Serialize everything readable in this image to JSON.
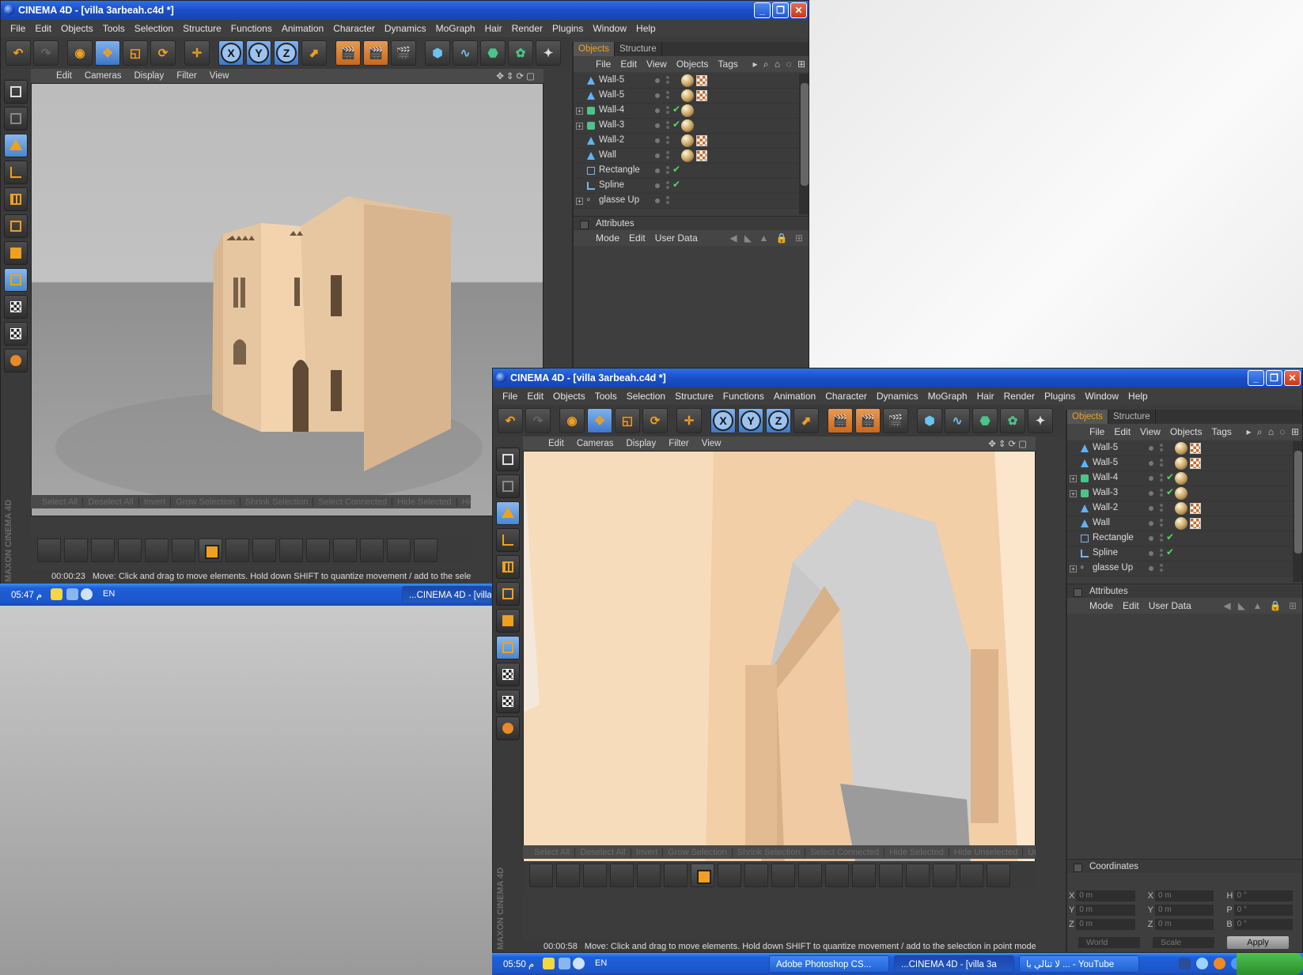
{
  "window1": {
    "title": "CINEMA 4D - [villa 3arbeah.c4d *]",
    "menu": [
      "File",
      "Edit",
      "Objects",
      "Tools",
      "Selection",
      "Structure",
      "Functions",
      "Animation",
      "Character",
      "Dynamics",
      "MoGraph",
      "Hair",
      "Render",
      "Plugins",
      "Window",
      "Help"
    ],
    "viewport_menu": [
      "Edit",
      "Cameras",
      "Display",
      "Filter",
      "View"
    ],
    "tabs": [
      "Objects",
      "Structure"
    ],
    "objects_menu": [
      "File",
      "Edit",
      "View",
      "Objects",
      "Tags"
    ],
    "objects": [
      {
        "name": "Wall-5",
        "icon": "polygon",
        "expand": false,
        "check": false,
        "tags": [
          "mat",
          "uv"
        ]
      },
      {
        "name": "Wall-5",
        "icon": "polygon",
        "expand": false,
        "check": false,
        "tags": [
          "mat",
          "uv"
        ]
      },
      {
        "name": "Wall-4",
        "icon": "cube",
        "expand": true,
        "check": true,
        "tags": [
          "mat"
        ]
      },
      {
        "name": "Wall-3",
        "icon": "cube",
        "expand": true,
        "check": true,
        "tags": [
          "mat"
        ]
      },
      {
        "name": "Wall-2",
        "icon": "polygon",
        "expand": false,
        "check": false,
        "tags": [
          "mat",
          "uv"
        ]
      },
      {
        "name": "Wall",
        "icon": "polygon",
        "expand": false,
        "check": false,
        "tags": [
          "mat",
          "uv"
        ]
      },
      {
        "name": "Rectangle",
        "icon": "rect",
        "expand": false,
        "check": true,
        "tags": []
      },
      {
        "name": "Spline",
        "icon": "spline",
        "expand": false,
        "check": true,
        "tags": []
      },
      {
        "name": "glasse Up",
        "icon": "null",
        "expand": true,
        "check": false,
        "tags": []
      }
    ],
    "attributes_label": "Attributes",
    "attributes_menu": [
      "Mode",
      "Edit",
      "User Data"
    ],
    "selection_bar": [
      "Select All",
      "Deselect All",
      "Invert",
      "Grow Selection",
      "Shrink Selection",
      "Select Connected",
      "Hide Selected",
      "Hide U"
    ],
    "time": "00:00:23",
    "status": "Move: Click and drag to move elements. Hold down SHIFT to quantize movement / add to the selection in",
    "brand": "MAXON CINEMA 4D"
  },
  "window2": {
    "title": "CINEMA 4D - [villa 3arbeah.c4d *]",
    "selection_bar": [
      "Select All",
      "Deselect All",
      "Invert",
      "Grow Selection",
      "Shrink Selection",
      "Select Connected",
      "Hide Selected",
      "Hide Unselected",
      "Unhide"
    ],
    "time": "00:00:58",
    "status": "Move: Click and drag to move elements. Hold down SHIFT to quantize movement / add to the selection in point mode, CTRL to",
    "coordinates_label": "Coordinates",
    "coord_rows": [
      {
        "a": "X",
        "av": "0 m",
        "b": "X",
        "bv": "0 m",
        "c": "H",
        "cv": "0 °"
      },
      {
        "a": "Y",
        "av": "0 m",
        "b": "Y",
        "bv": "0 m",
        "c": "P",
        "cv": "0 °"
      },
      {
        "a": "Z",
        "av": "0 m",
        "b": "Z",
        "bv": "0 m",
        "c": "B",
        "cv": "0 °"
      }
    ],
    "coord_world": "World",
    "coord_scale": "Scale",
    "apply": "Apply"
  },
  "taskbar1": {
    "clock": "05:47 م",
    "lang": "EN",
    "task": "...CINEMA 4D - [villa"
  },
  "taskbar2": {
    "clock": "05:50 م",
    "lang": "EN",
    "tasks": [
      "Adobe Photoshop CS...",
      "...CINEMA 4D - [villa 3a",
      "لا تنالي با ... - YouTube"
    ]
  },
  "colors": {
    "accent": "#f0a020",
    "xp_blue": "#1d56c9",
    "panel": "#3c3c3c"
  }
}
